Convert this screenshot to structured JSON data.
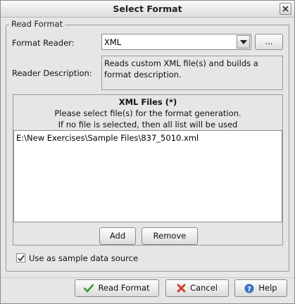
{
  "window": {
    "title": "Select Format"
  },
  "group": {
    "legend": "Read Format"
  },
  "format_reader": {
    "label": "Format Reader:",
    "value": "XML",
    "browse_label": "..."
  },
  "reader_description": {
    "label": "Reader Description:",
    "text": "Reads custom XML file(s) and builds a format description."
  },
  "xml_files": {
    "title": "XML Files (*)",
    "line1": "Please select file(s) for the format generation.",
    "line2": "If no file is selected, then all list will be used",
    "files": [
      "E:\\New Exercises\\Sample Files\\837_5010.xml"
    ],
    "add_label": "Add",
    "remove_label": "Remove"
  },
  "sample_source": {
    "label": "Use as sample data source",
    "checked": true
  },
  "footer": {
    "read_format_label": "Read Format",
    "cancel_label": "Cancel",
    "help_label": "Help"
  },
  "colors": {
    "ok_green": "#2e9e2e",
    "cancel_red": "#d03a2a",
    "help_blue": "#3a6fc4"
  }
}
